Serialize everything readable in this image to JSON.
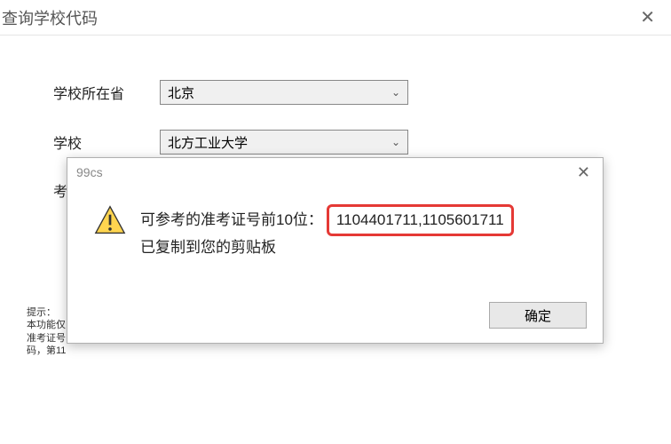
{
  "main": {
    "title": "查询学校代码",
    "form": {
      "province_label": "学校所在省",
      "province_value": "北京",
      "school_label": "学校",
      "school_value": "北方工业大学",
      "partial_label": "考"
    },
    "hint": {
      "line1": "提示：",
      "line2": "本功能仅",
      "line3": "准考证号",
      "line4": "码，第11"
    }
  },
  "modal": {
    "title": "99cs",
    "message_prefix": "可参考的准考证号前10位：",
    "message_numbers": "1104401711,1105601711",
    "message_line2": "已复制到您的剪贴板",
    "ok_label": "确定"
  }
}
